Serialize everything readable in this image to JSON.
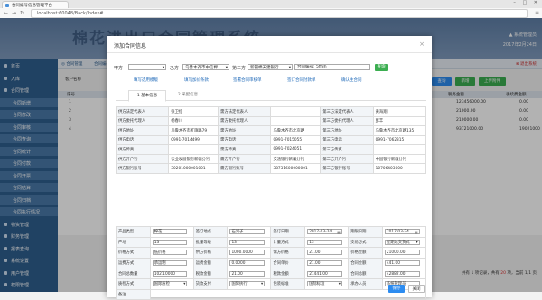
{
  "browser": {
    "tab_title": "合同编号信息管理平台",
    "url": "localhost:60048/Back/Index#",
    "window_buttons": "– □ ✕"
  },
  "app": {
    "title": "棉花进出口合同管理系统",
    "user": "▲ 系统管理员",
    "date": "2017年2月24日"
  },
  "sidebar": {
    "items": [
      {
        "label": "首页",
        "sub": false
      },
      {
        "label": "入库",
        "sub": false
      },
      {
        "label": "合同管理",
        "sub": false
      },
      {
        "label": "合同新增",
        "sub": true
      },
      {
        "label": "合同修改",
        "sub": true
      },
      {
        "label": "合同审核",
        "sub": true
      },
      {
        "label": "合同查询",
        "sub": true
      },
      {
        "label": "合同统计",
        "sub": true
      },
      {
        "label": "合同付款",
        "sub": true
      },
      {
        "label": "合同开票",
        "sub": true
      },
      {
        "label": "合同结算",
        "sub": true
      },
      {
        "label": "合同归档",
        "sub": true
      },
      {
        "label": "合同执行情况",
        "sub": true
      },
      {
        "label": "物资管理",
        "sub": false
      },
      {
        "label": "财务管理",
        "sub": false
      },
      {
        "label": "报表查询",
        "sub": false
      },
      {
        "label": "系统设置",
        "sub": false
      },
      {
        "label": "用户管理",
        "sub": false
      },
      {
        "label": "权限管理",
        "sub": false
      }
    ]
  },
  "breadcrumb": {
    "home": "◎ 合同管理",
    "current": "合同编号",
    "logout": "⊗ 退出系统"
  },
  "background": {
    "filter_label": "客户名称",
    "buttons": [
      "查询",
      "新增",
      "上传附件"
    ],
    "columns": [
      "序号",
      "税务金额",
      "手续费金额"
    ],
    "rows": [
      {
        "num": "1",
        "a": "123456000.00",
        "b": "0.00"
      },
      {
        "num": "2",
        "a": "21000.00",
        "b": "0.00"
      },
      {
        "num": "3",
        "a": "210000.00",
        "b": "0.00"
      },
      {
        "num": "4",
        "a": "93721000.00",
        "b": "19021000"
      }
    ],
    "pager_prefix": "共有 1 项记录，共有",
    "pager_count": "20",
    "pager_suffix": "项，当前 1/1 页"
  },
  "modal": {
    "title": "添加合同信息",
    "close": "×",
    "filters": {
      "party_a_label": "甲方",
      "party_a_value": "",
      "party_b_label": "乙方",
      "party_b_value": "乌鲁木齐市中信棉",
      "party_c_label": "第三方",
      "party_c_value": "新疆棉天建银行",
      "contract_no_label": "合同编号",
      "contract_no_value": "合同编号: 5ff3h",
      "search_button": "查询"
    },
    "links": [
      "填写选用模版",
      "填写加价条款",
      "签署合同审核单",
      "签订合同付款单",
      "确认主合同"
    ],
    "tabs": [
      "1 基本信息",
      "2 采配信息"
    ],
    "info_rows": [
      [
        "供方法定代表人",
        "张卫红",
        "需方法定代表人",
        "",
        "第三方法定代表人",
        "黄海翔"
      ],
      [
        "供方委托代理人",
        "杨春川",
        "需方委托代理人",
        "",
        "第三方委托代理人",
        "彭丰"
      ],
      [
        "供方地址",
        "乌鲁木齐市红旗路79",
        "需方地址",
        "乌鲁木齐市北京路",
        "第三方地址",
        "乌鲁木齐市北京路135"
      ],
      [
        "供方电话",
        "0991-7014499",
        "需方电话",
        "0991-7015055",
        "第三方电话",
        "0991-7062315"
      ],
      [
        "供方传真",
        "",
        "需方传真",
        "0991-7024051",
        "第三方传真",
        ""
      ],
      [
        "供方开户行",
        "农业发展银行新疆分行",
        "需方开户行",
        "交通银行新疆分行",
        "第三方开户行",
        "中国银行新疆分行"
      ],
      [
        "供方银行账号",
        "30201000001001",
        "需方银行账号",
        "38731600000001",
        "第三方银行账号",
        "10706403000"
      ]
    ],
    "detail_rows": [
      [
        "产品类型",
        "棉花",
        "签订地点",
        "石河子",
        "签订日期",
        "2017-03-24",
        "期限日期",
        "2017-03-24"
      ],
      [
        "产地",
        "13",
        "批量等级",
        "13",
        "计量方式",
        "13",
        "交易方式",
        "星期达交货式"
      ],
      [
        "价格方式",
        "低价格",
        "供方价格",
        "1000.0000",
        "需方价格",
        "21.00",
        "价格金额",
        "21000.00"
      ],
      [
        "运费方式",
        "承运制",
        "运费金额",
        "0.0000",
        "合同单价",
        "21.00",
        "合同金额",
        "441.00"
      ],
      [
        "合同总数量",
        "1021.0000",
        "税款金额",
        "21.00",
        "税款金额",
        "21441.00",
        "合同总额",
        "42882.00"
      ],
      [
        "质检方式",
        "国际质检",
        "货款支付",
        "国际执行",
        "包装标准",
        "国际标准",
        "承办人员",
        "系统管理员"
      ],
      [
        "备注",
        "",
        "",
        "",
        "",
        "",
        "",
        ""
      ]
    ],
    "save_button": "保存",
    "close_button": "关闭"
  },
  "colors": {
    "sidebar_bg": "#2f5f8f",
    "header_bg": "#6f8db2",
    "save_blue": "#2d8cf0",
    "green": "#3cae51"
  }
}
